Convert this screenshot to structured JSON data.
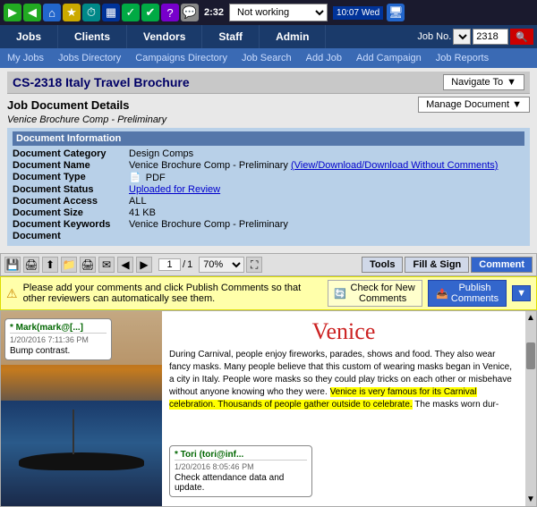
{
  "topbar": {
    "time": "2:32",
    "status": "Not working",
    "clock": "10:07\nWed"
  },
  "mainnav": {
    "items": [
      "Jobs",
      "Clients",
      "Vendors",
      "Staff",
      "Admin"
    ],
    "job_label": "Job No.",
    "job_number": "2318"
  },
  "subnav": {
    "items": [
      "My Jobs",
      "Jobs Directory",
      "Campaigns Directory",
      "Job Search",
      "Add Job",
      "Add Campaign",
      "Job Reports"
    ]
  },
  "job": {
    "title": "CS-2318 Italy Travel Brochure",
    "navigate_to": "Navigate To",
    "section_title": "Job Document Details",
    "sub_title": "Venice Brochure Comp - Preliminary",
    "manage_doc": "Manage Document"
  },
  "doc_info": {
    "header": "Document Information",
    "fields": [
      {
        "label": "Document Category",
        "value": "Design Comps",
        "is_link": false
      },
      {
        "label": "Document Name",
        "value": "Venice Brochure Comp - Preliminary ",
        "link_text": "(View/Download/Download Without Comments)",
        "is_link": true
      },
      {
        "label": "Document Type",
        "value": "PDF",
        "is_link": false,
        "has_icon": true
      },
      {
        "label": "Document Status",
        "value": "Uploaded for Review",
        "is_link": true
      },
      {
        "label": "Document Access",
        "value": "ALL",
        "is_link": false
      },
      {
        "label": "Document Size",
        "value": "41 KB",
        "is_link": false
      },
      {
        "label": "Document Keywords",
        "value": "Venice Brochure Comp - Preliminary",
        "is_link": false
      },
      {
        "label": "Document",
        "value": "",
        "is_link": false
      }
    ]
  },
  "pdf_viewer": {
    "page_current": "1",
    "page_total": "1",
    "zoom": "70%",
    "tools_btn": "Tools",
    "fill_sign_btn": "Fill & Sign",
    "comment_btn": "Comment"
  },
  "notice_bar": {
    "text": "Please add your comments and click Publish Comments so that other reviewers can automatically see them.",
    "check_btn": "Check for New Comments",
    "publish_btn": "Publish Comments"
  },
  "doc_content": {
    "venice_title": "Venice",
    "comment1": {
      "author": "* Mark(mark@[...]",
      "date": "1/20/2016 7:11:36 PM",
      "text": "Bump contrast."
    },
    "comment2": {
      "author": "* Tori (tori@inf...",
      "date": "1/20/2016 8:05:46 PM",
      "text": "Check attendance data and update."
    },
    "body_text": "During Carnival, people enjoy fireworks, parades, shows and food. They also wear fancy masks. Many people believe that this custom of wearing masks began in Venice, a city in Italy. People wore masks so they could play tricks on each other or misbehave without anyone knowing who they were.",
    "highlighted_text": "Venice is very famous for its Carnival celebration. Thousands of people gather outside to celebrate.",
    "trailing_text": " The masks worn dur-"
  }
}
